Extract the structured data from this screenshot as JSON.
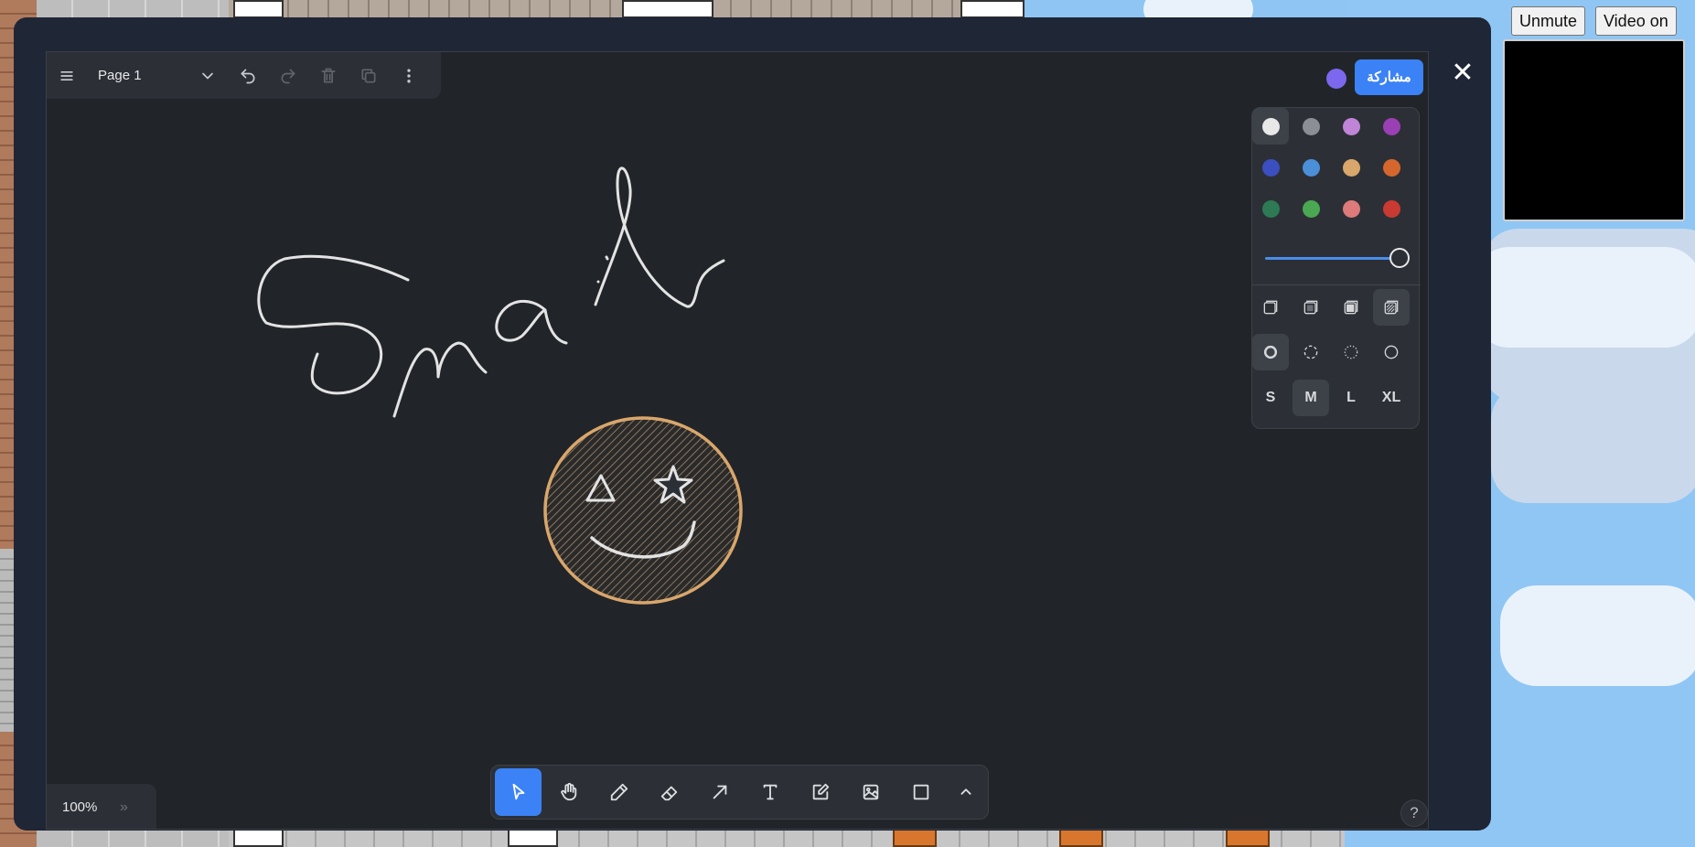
{
  "media": {
    "unmute_label": "Unmute",
    "video_label": "Video on"
  },
  "whiteboard": {
    "page_name": "Page 1",
    "share_label": "مشاركة",
    "zoom_level": "100%",
    "help_label": "?",
    "close_icon": "close-icon",
    "avatar_color": "#7b68ee",
    "accent_color": "#3b82f6"
  },
  "style_panel": {
    "colors": [
      {
        "name": "white",
        "hex": "#e8e8e8",
        "selected": true
      },
      {
        "name": "grey",
        "hex": "#8b8e94",
        "selected": false
      },
      {
        "name": "light-violet",
        "hex": "#c084d8",
        "selected": false
      },
      {
        "name": "violet",
        "hex": "#9b3fb5",
        "selected": false
      },
      {
        "name": "blue",
        "hex": "#3b4fc0",
        "selected": false
      },
      {
        "name": "light-blue",
        "hex": "#4b8fd9",
        "selected": false
      },
      {
        "name": "yellow",
        "hex": "#d9a66b",
        "selected": false
      },
      {
        "name": "orange",
        "hex": "#d5672c",
        "selected": false
      },
      {
        "name": "green",
        "hex": "#2d7a55",
        "selected": false
      },
      {
        "name": "light-green",
        "hex": "#4aa852",
        "selected": false
      },
      {
        "name": "light-red",
        "hex": "#dd7a7a",
        "selected": false
      },
      {
        "name": "red",
        "hex": "#c83a32",
        "selected": false
      }
    ],
    "opacity": 1.0,
    "fill_options": [
      "fill-none",
      "fill-semi",
      "fill-solid",
      "fill-pattern"
    ],
    "fill_selected": "fill-pattern",
    "dash_options": [
      "dash-draw",
      "dash-dashed",
      "dash-dotted",
      "dash-solid"
    ],
    "dash_selected": "dash-draw",
    "sizes": [
      "S",
      "M",
      "L",
      "XL"
    ],
    "size_selected": "M"
  },
  "toolbar": {
    "tools": [
      "select",
      "hand",
      "draw",
      "eraser",
      "arrow",
      "text",
      "note",
      "image",
      "rectangle",
      "more"
    ],
    "active_tool": "select"
  }
}
